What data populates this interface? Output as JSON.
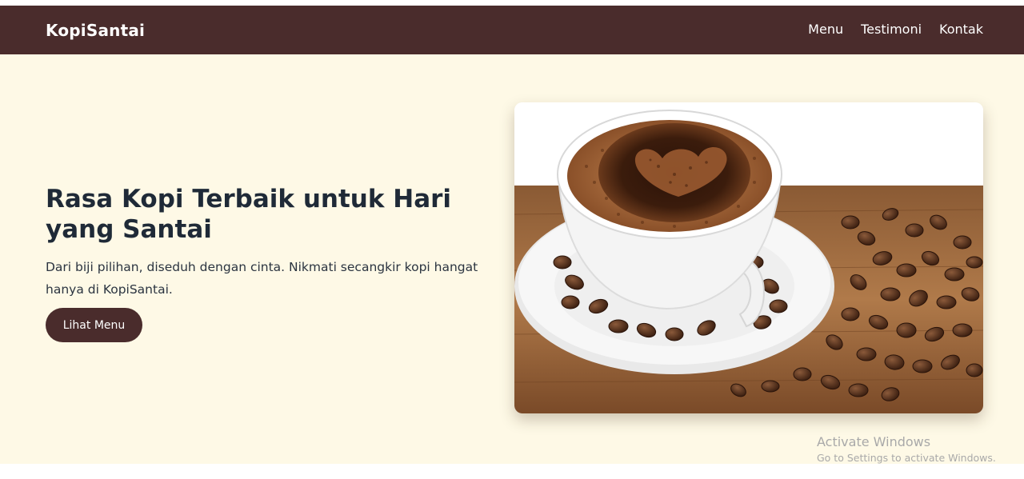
{
  "navbar": {
    "brand": "KopiSantai",
    "links": [
      "Menu",
      "Testimoni",
      "Kontak"
    ]
  },
  "hero": {
    "title": "Rasa Kopi Terbaik untuk Hari yang Santai",
    "description": "Dari biji pilihan, diseduh dengan cinta. Nikmati secangkir kopi hangat hanya di KopiSantai.",
    "button_label": "Lihat Menu",
    "image_subject": "coffee-cup-with-beans"
  },
  "watermark": {
    "title": "Activate Windows",
    "subtitle": "Go to Settings to activate Windows."
  },
  "colors": {
    "navbar_bg": "#4a2c2c",
    "hero_bg": "#fef9e6",
    "heading_text": "#1f2a37",
    "button_bg": "#4a2c2c"
  }
}
